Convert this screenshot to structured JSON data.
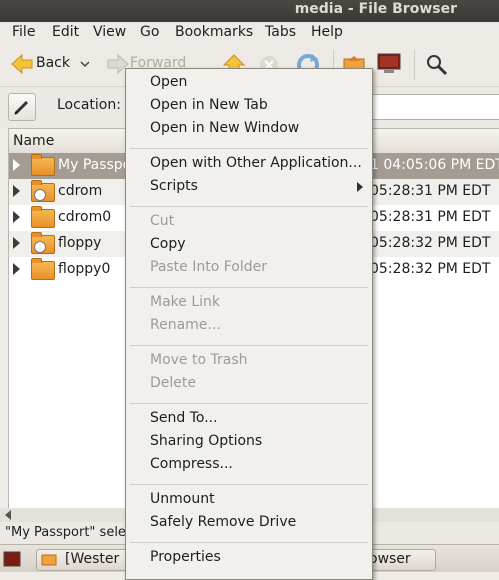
{
  "window": {
    "title": "media - File Browser"
  },
  "menubar": {
    "items": [
      {
        "label": "File"
      },
      {
        "label": "Edit"
      },
      {
        "label": "View"
      },
      {
        "label": "Go"
      },
      {
        "label": "Bookmarks"
      },
      {
        "label": "Tabs"
      },
      {
        "label": "Help"
      }
    ]
  },
  "toolbar": {
    "back_label": "Back",
    "forward_label": "Forward",
    "icons": [
      "back-arrow-icon",
      "forward-arrow-icon",
      "up-arrow-icon",
      "stop-icon",
      "reload-icon",
      "home-folder-icon",
      "computer-icon",
      "search-icon"
    ]
  },
  "location": {
    "label": "Location:",
    "value": ""
  },
  "list": {
    "header_name": "Name",
    "rows": [
      {
        "name": "My Passport",
        "date": "1 04:05:06 PM EDT",
        "selected": true
      },
      {
        "name": "cdrom",
        "date": "05:28:31 PM EDT"
      },
      {
        "name": "cdrom0",
        "date": "05:28:31 PM EDT"
      },
      {
        "name": "floppy",
        "date": "05:28:32 PM EDT"
      },
      {
        "name": "floppy0",
        "date": "05:28:32 PM EDT"
      }
    ]
  },
  "status": {
    "text": "\"My Passport\" sele"
  },
  "taskbar": {
    "items": [
      {
        "label": "[Wester"
      },
      {
        "label": "owser"
      }
    ]
  },
  "context_menu": {
    "groups": [
      [
        {
          "label": "Open"
        },
        {
          "label": "Open in New Tab"
        },
        {
          "label": "Open in New Window"
        }
      ],
      [
        {
          "label": "Open with Other Application..."
        },
        {
          "label": "Scripts",
          "submenu": true
        }
      ],
      [
        {
          "label": "Cut",
          "disabled": true
        },
        {
          "label": "Copy"
        },
        {
          "label": "Paste Into Folder",
          "disabled": true
        }
      ],
      [
        {
          "label": "Make Link",
          "disabled": true
        },
        {
          "label": "Rename...",
          "disabled": true
        }
      ],
      [
        {
          "label": "Move to Trash",
          "disabled": true
        },
        {
          "label": "Delete",
          "disabled": true
        }
      ],
      [
        {
          "label": "Send To..."
        },
        {
          "label": "Sharing Options"
        },
        {
          "label": "Compress..."
        }
      ],
      [
        {
          "label": "Unmount"
        },
        {
          "label": "Safely Remove Drive"
        }
      ],
      [
        {
          "label": "Properties"
        }
      ]
    ]
  },
  "colors": {
    "titlebar": "#3c3b37",
    "selection": "#a39c93",
    "folder": "#f0a33c",
    "accent": "#e07a2a"
  }
}
